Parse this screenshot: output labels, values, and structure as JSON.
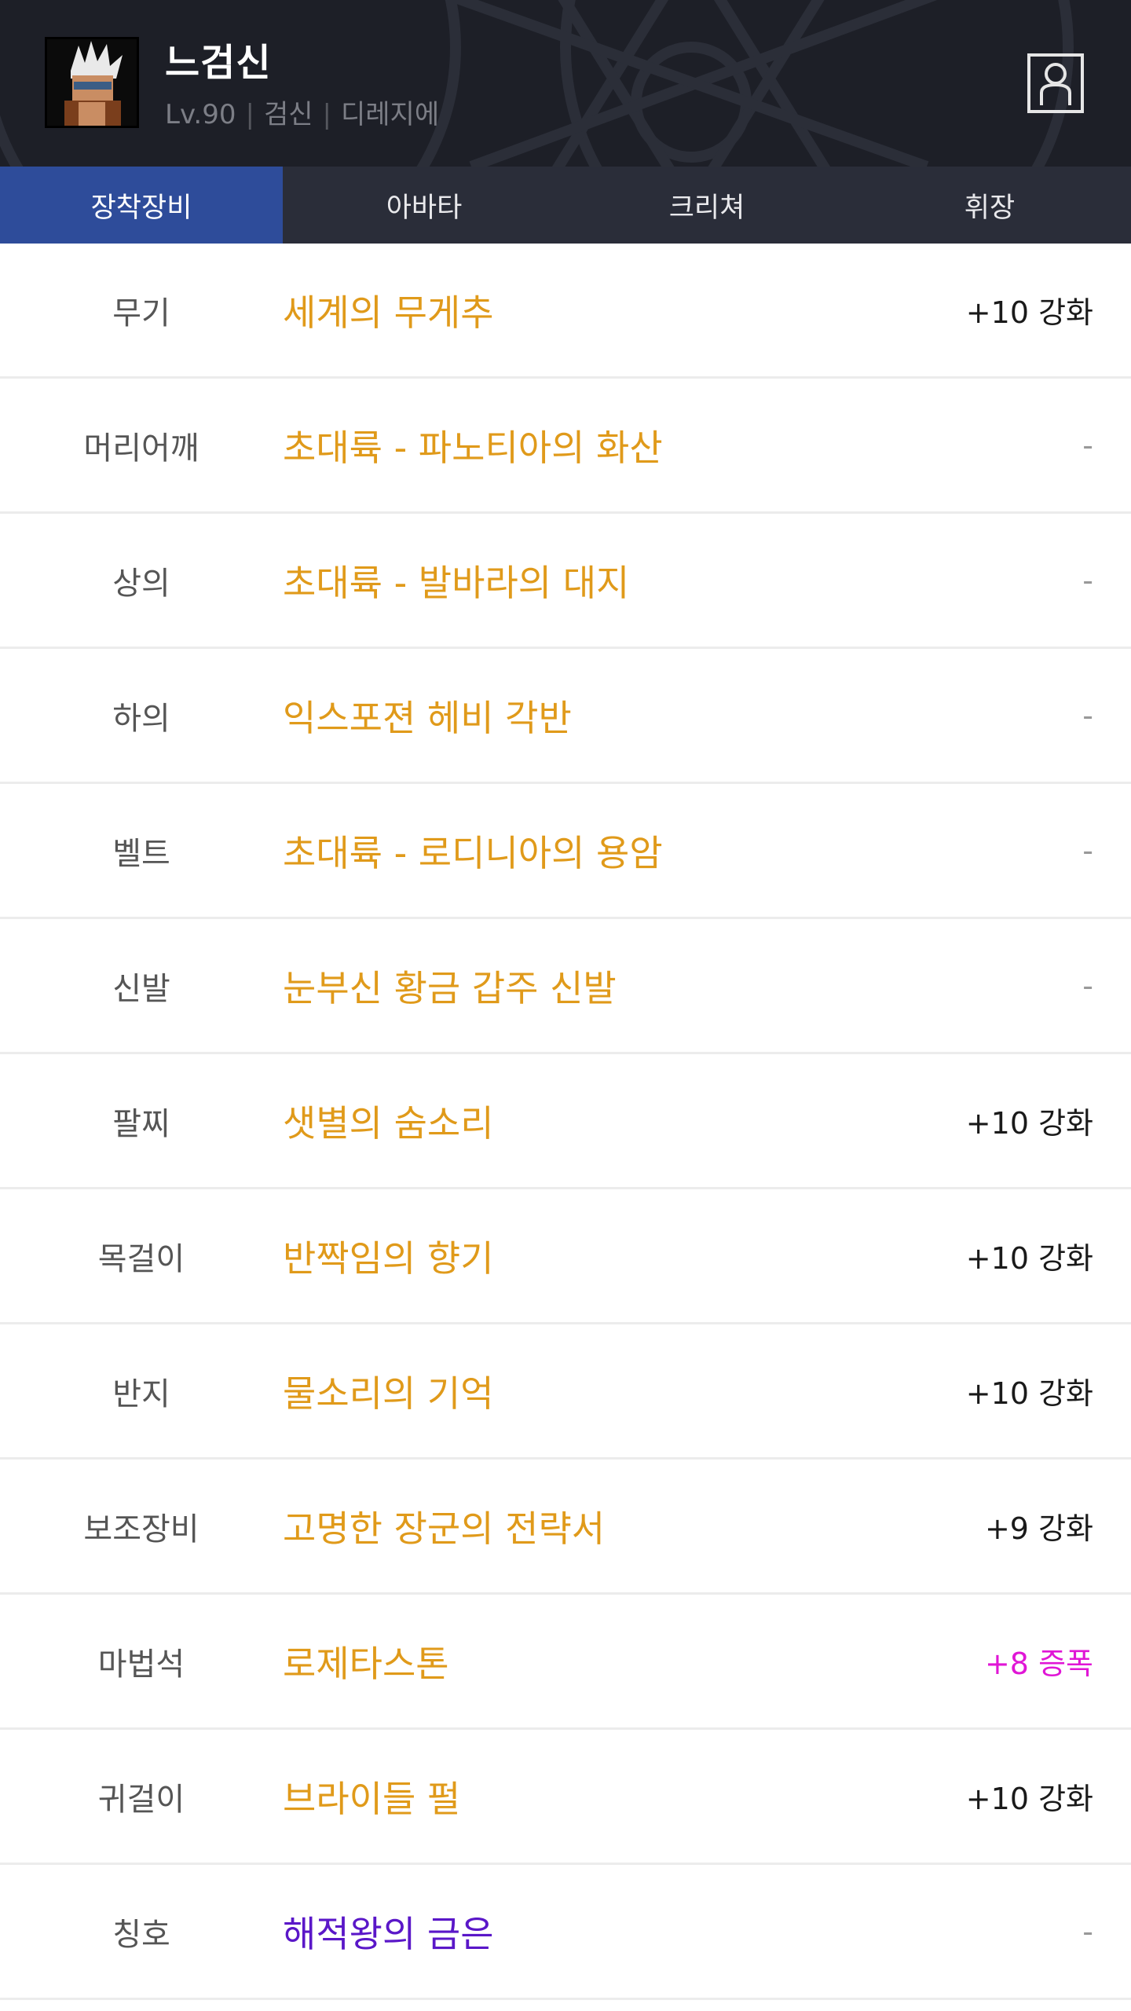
{
  "header": {
    "name": "느검신",
    "level": "Lv.90",
    "job": "검신",
    "server": "디레지에"
  },
  "tabs": [
    {
      "label": "장착장비",
      "active": true
    },
    {
      "label": "아바타",
      "active": false
    },
    {
      "label": "크리쳐",
      "active": false
    },
    {
      "label": "휘장",
      "active": false
    }
  ],
  "equipment": [
    {
      "slot": "무기",
      "item": "세계의 무게추",
      "enhance": "+10 강화"
    },
    {
      "slot": "머리어깨",
      "item": "초대륙 - 파노티아의 화산",
      "enhance": "-"
    },
    {
      "slot": "상의",
      "item": "초대륙 - 발바라의 대지",
      "enhance": "-"
    },
    {
      "slot": "하의",
      "item": "익스포젼 헤비 각반",
      "enhance": "-"
    },
    {
      "slot": "벨트",
      "item": "초대륙 - 로디니아의 용암",
      "enhance": "-"
    },
    {
      "slot": "신발",
      "item": "눈부신 황금 갑주 신발",
      "enhance": "-"
    },
    {
      "slot": "팔찌",
      "item": "샛별의 숨소리",
      "enhance": "+10 강화"
    },
    {
      "slot": "목걸이",
      "item": "반짝임의 향기",
      "enhance": "+10 강화"
    },
    {
      "slot": "반지",
      "item": "물소리의 기억",
      "enhance": "+10 강화"
    },
    {
      "slot": "보조장비",
      "item": "고명한 장군의 전략서",
      "enhance": "+9 강화"
    },
    {
      "slot": "마법석",
      "item": "로제타스톤",
      "enhance": "+8 증폭"
    },
    {
      "slot": "귀걸이",
      "item": "브라이들 펄",
      "enhance": "+10 강화"
    },
    {
      "slot": "칭호",
      "item": "해적왕의 금은",
      "enhance": "-"
    }
  ],
  "colors": {
    "header_bg": "#1d1f27",
    "tab_bg": "#2a2d39",
    "tab_active": "#2e4c9a",
    "item_epic": "#e09a1a",
    "item_unique": "#5a17c8",
    "amplify": "#e016d6"
  },
  "icons": {
    "avatar": "character-portrait",
    "profile": "person-icon"
  }
}
